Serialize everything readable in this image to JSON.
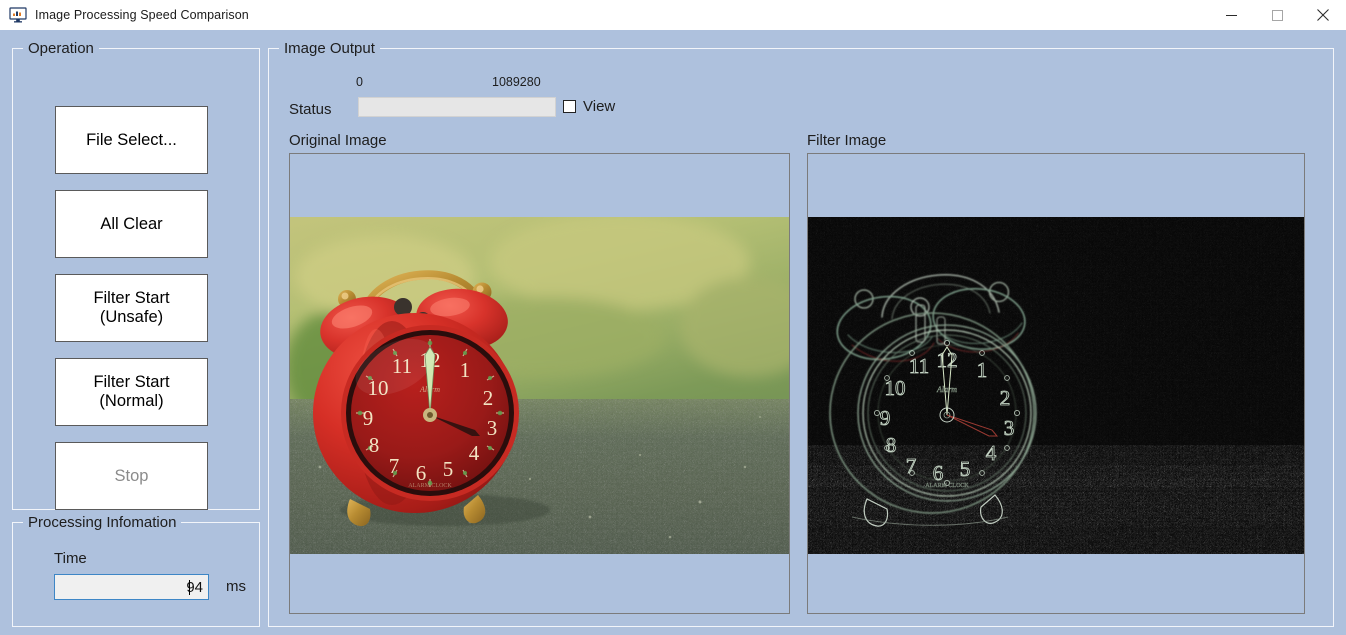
{
  "window": {
    "title": "Image Processing Speed Comparison",
    "icon": "monitor-chart-icon",
    "controls": {
      "minimize": "minimize-icon",
      "maximize": "maximize-icon",
      "close": "close-icon"
    }
  },
  "colors": {
    "form_background": "#aec1dd",
    "titlebar_background": "#ffffff",
    "button_face": "#ffffff",
    "button_border": "#5a5a5a",
    "groupbox_border": "#f2f5fa",
    "textbox_border_focus": "#3d86c6",
    "progress_track": "#e6e6e6",
    "disabled_text": "#8b8b8b",
    "text": "#1d1d1d"
  },
  "operation": {
    "title": "Operation",
    "buttons": [
      {
        "label": "File Select...",
        "enabled": true
      },
      {
        "label": "All Clear",
        "enabled": true
      },
      {
        "label": "Filter Start\n(Unsafe)",
        "enabled": true
      },
      {
        "label": "Filter Start\n(Normal)",
        "enabled": true
      },
      {
        "label": "Stop",
        "enabled": false
      }
    ]
  },
  "processing_information": {
    "title": "Processing Infomation",
    "time_label": "Time",
    "time_value": "94",
    "time_unit": "ms"
  },
  "image_output": {
    "title": "Image Output",
    "progress_min_label": "0",
    "progress_max_label": "1089280",
    "status_label": "Status",
    "progress_value": 0,
    "view_checkbox": {
      "label": "View",
      "checked": false
    },
    "original": {
      "label": "Original Image",
      "description": "red twin-bell alarm clock on asphalt, blurred green background"
    },
    "filter": {
      "label": "Filter Image",
      "description": "edge-detected alarm clock, glowing outlines on black"
    }
  }
}
